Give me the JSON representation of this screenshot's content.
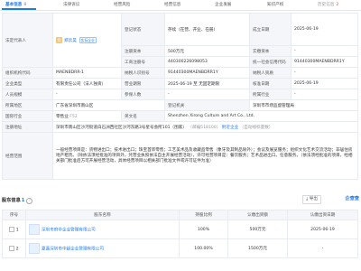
{
  "tabs": [
    {
      "label": "基本信息",
      "count": "8"
    },
    {
      "label": "法律诉讼",
      "count": ""
    },
    {
      "label": "经营风险",
      "count": ""
    },
    {
      "label": "经营信息",
      "count": ""
    },
    {
      "label": "企业发展",
      "count": ""
    },
    {
      "label": "知识产权",
      "count": ""
    },
    {
      "label": "历史信息",
      "count": "2"
    }
  ],
  "info": {
    "legal_rep_label": "法定代表人",
    "legal_rep_avatar": "郑",
    "legal_rep_name": "郑云昊",
    "legal_rep_tag": "实际企业",
    "reg_status_label": "登记状态",
    "reg_status": "存续（在营、开业、在册）",
    "est_date_label": "成立日期",
    "est_date": "2025-06-19",
    "reg_no_label": "工商注册号",
    "reg_no": "440300226098053",
    "reg_capital_label": "注册资本",
    "reg_capital": "500万元",
    "paid_capital_label": "实缴资本",
    "paid_capital": "-",
    "org_code_label": "组织机构代码",
    "org_code": "MAENBDRR-1",
    "taxpayer_id_label": "纳税人识别号",
    "taxpayer_id": "91440300MAENBDRR1Y",
    "credit_code_label": "统一社会信用代码",
    "credit_code": "91440300MAENBDRR1Y",
    "company_type_label": "企业类型",
    "company_type": "有限责任公司（法人独资）",
    "term_label": "营业期限",
    "term": "2025-06-19 至 无固定期限",
    "taxpayer_quality_label": "纳税人资质",
    "taxpayer_quality": "-",
    "approval_date_label": "核准日期",
    "approval_date": "2025-06-19",
    "staff_label": "人员规模",
    "staff": "-",
    "insured_label": "参保人数",
    "insured": "-",
    "industry_label": "所属行业",
    "industry": "-",
    "region_label": "所属地区",
    "region": "广东省深圳市南山区",
    "authority_label": "登记机关",
    "authority": "深圳市市场监督管理局",
    "import_label": "国际行业",
    "import_value": "零售业",
    "import_extra": "F52",
    "en_name_label": "英文名",
    "en_name": "Shenzhen Xirong Culture and Art Co., Ltd.",
    "address_label": "注册地址",
    "address": "深圳市南山区沙河街道白石洲西社区沙河东路3号星号会所101（围家）",
    "address_postcode": "（邮编518100）",
    "address_link": "附近企业",
    "address_tail": "（自动线标量数）",
    "scope_label": "经营范围",
    "scope": "一般经营项目是：货物进出口；技术进出口；珠宝首饰零售；工艺美术品及收藏品零售（象牙及其制品除外）；会议及展览服务；组织文化艺术交流活动；非居住房地产租赁。（除依法须经批准的项目外，凭营业执照依法自主开展经营活动），许可经营项目是：餐饮服务；艺术品进出口。任意服务。（依法须经批准的项目，经相关部门批准后方可开展经营活动，具体经营项目以相关部门批准文件或许可证件为准）"
  },
  "branch": {
    "title": "股东信息",
    "count": "1",
    "export_label": "导出",
    "brand": "企查查",
    "headers": [
      "序号",
      "股东名称",
      "持股比例",
      "认缴出资额",
      "认缴出资日期"
    ],
    "rows": [
      {
        "index": "1",
        "name": "深圳市府中企业管理有限公司",
        "ratio": "100%",
        "amount": "500万元",
        "date": "2025-06-19"
      },
      {
        "index": "2",
        "name": "夏嘉深圳市中超企业管理有限公司",
        "ratio": "100.00%",
        "amount": "1500万元",
        "date": "-"
      }
    ]
  }
}
